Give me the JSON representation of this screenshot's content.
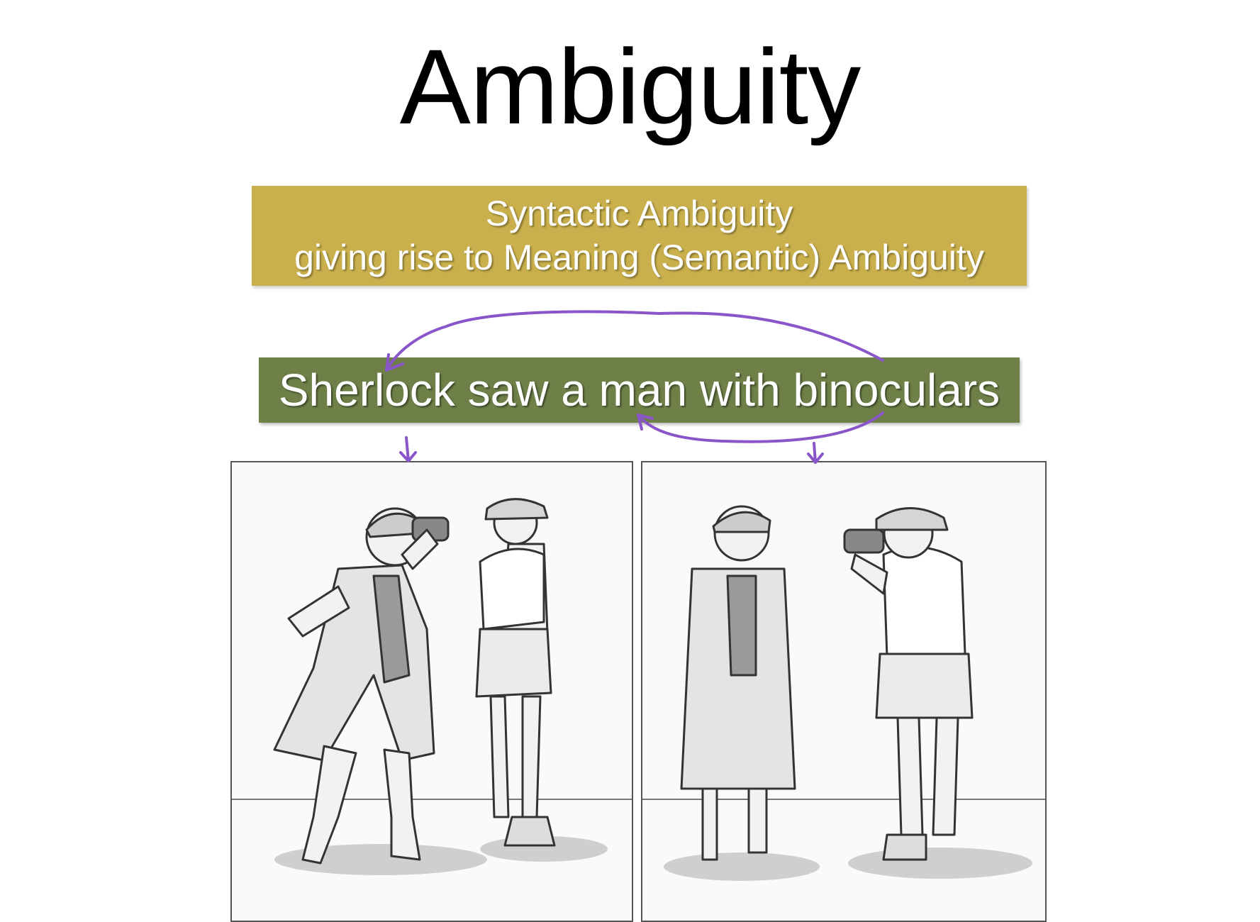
{
  "slide": {
    "title": "Ambiguity",
    "subtitle_line1": "Syntactic Ambiguity",
    "subtitle_line2": "giving rise to Meaning (Semantic) Ambiguity",
    "sentence": "Sherlock saw a man with binoculars"
  },
  "colors": {
    "gold_box": "#c9b04c",
    "green_box": "#6e8048",
    "annotation": "#8a55c8"
  },
  "illustrations": {
    "left_panel": "sherlock-with-binoculars-illustration",
    "right_panel": "man-with-binoculars-illustration"
  }
}
